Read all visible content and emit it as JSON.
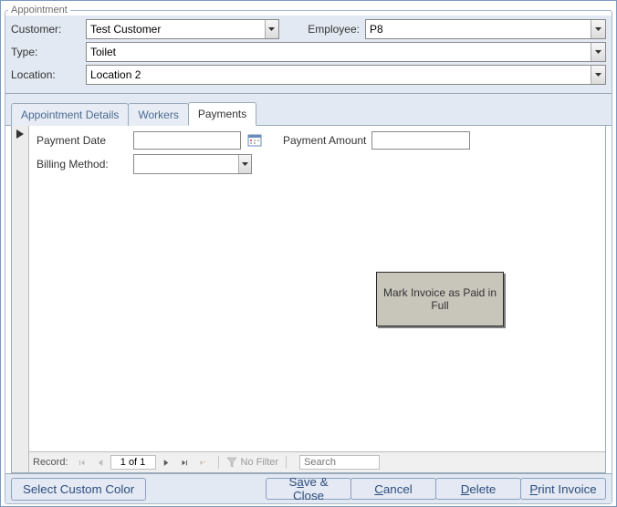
{
  "window_title": "Appointment",
  "header": {
    "customer_label": "Customer:",
    "customer_value": "Test Customer",
    "employee_label": "Employee:",
    "employee_value": "P8",
    "type_label": "Type:",
    "type_value": "Toilet",
    "location_label": "Location:",
    "location_value": "Location 2"
  },
  "tabs": {
    "t0": "Appointment Details",
    "t1": "Workers",
    "t2": "Payments"
  },
  "payments": {
    "payment_date_label": "Payment Date",
    "payment_date_value": "",
    "payment_amount_label": "Payment Amount",
    "payment_amount_value": "",
    "billing_method_label": "Billing Method:",
    "billing_method_value": "",
    "mark_paid_button": "Mark Invoice as Paid in Full"
  },
  "recordnav": {
    "label": "Record:",
    "position": "1 of 1",
    "filter_text": "No Filter",
    "search_placeholder": "Search"
  },
  "footer": {
    "select_color": "Select Custom Color",
    "save_close_pre": "S",
    "save_close_u": "a",
    "save_close_post": "ve & Close",
    "cancel_u": "C",
    "cancel_post": "ancel",
    "delete_u": "D",
    "delete_post": "elete",
    "print_u": "P",
    "print_post": "rint Invoice"
  }
}
